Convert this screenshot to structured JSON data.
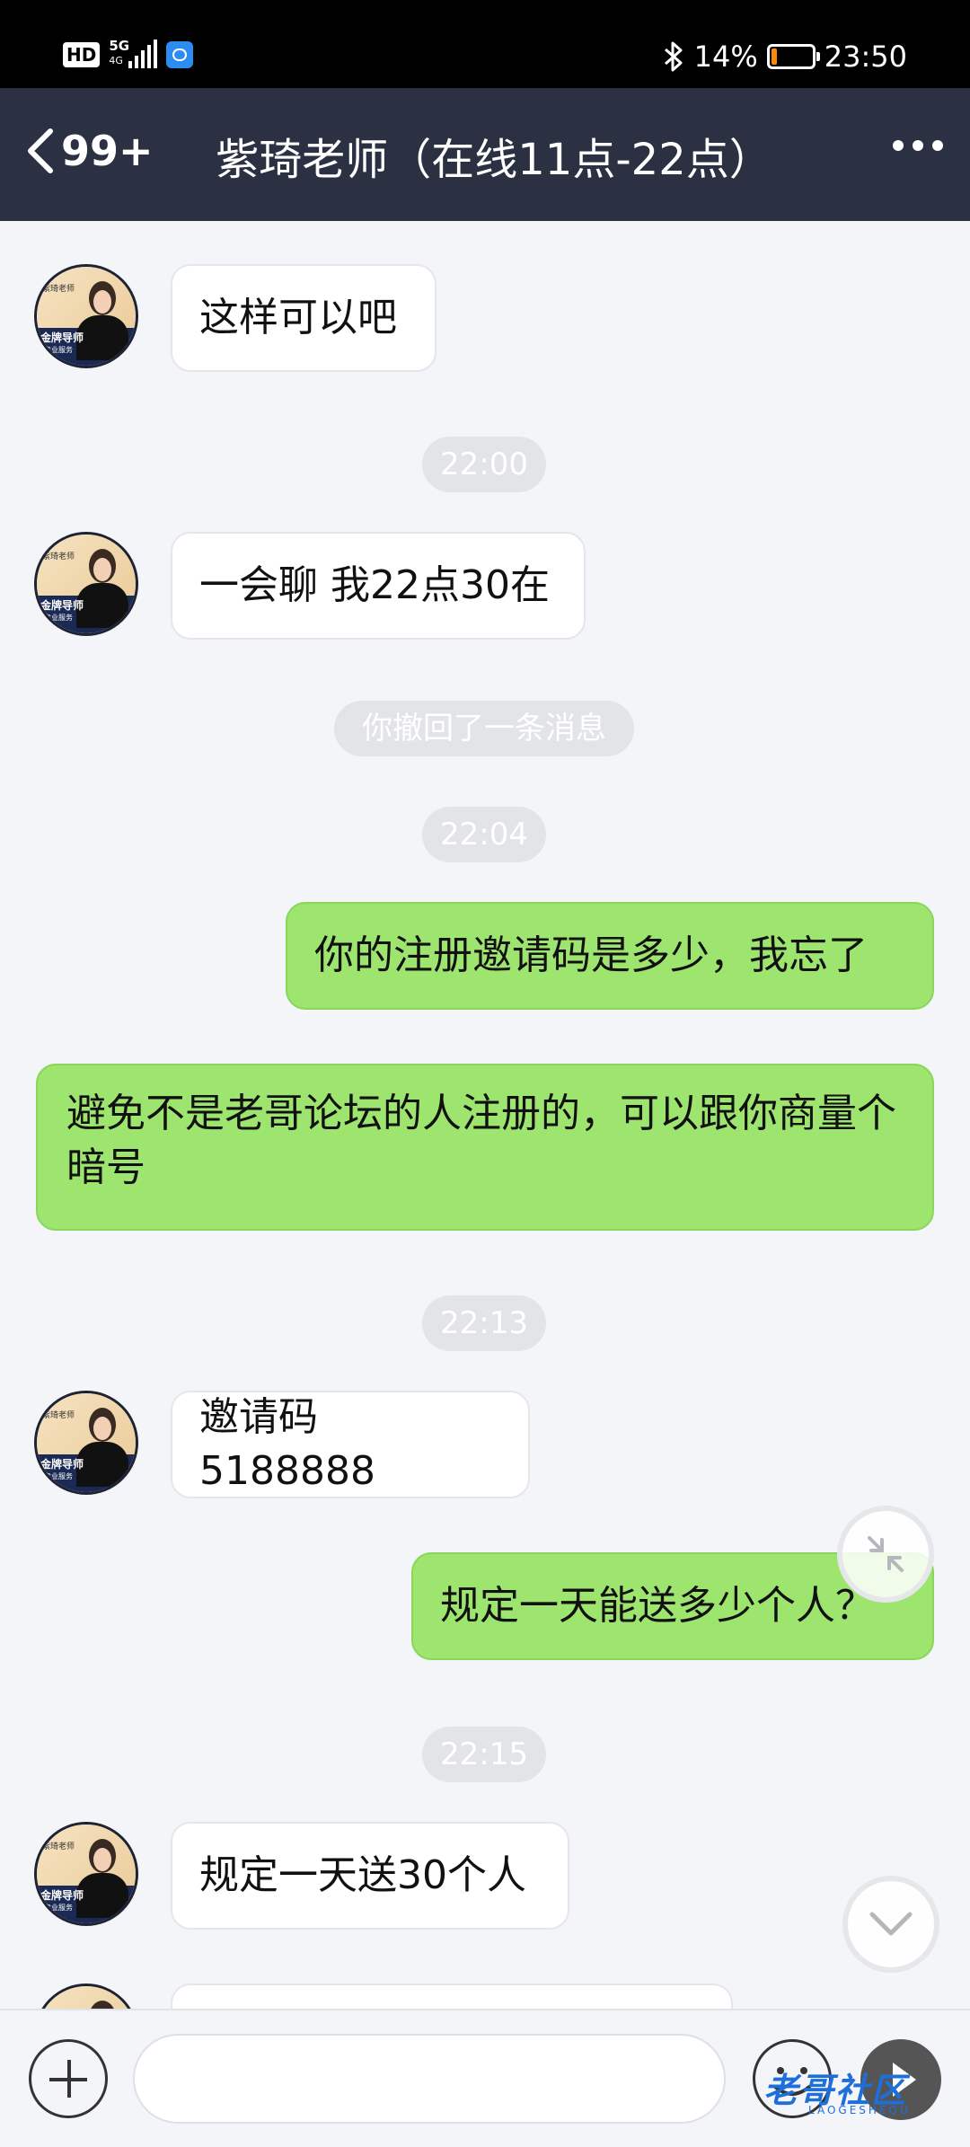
{
  "status_bar": {
    "hd": "HD",
    "network": "5G",
    "network_sub": "4G",
    "battery_percent": "14%",
    "battery_level": 0.14,
    "time": "23:50",
    "icons": [
      "signal-icon",
      "app-notification-icon",
      "bluetooth-icon",
      "battery-icon"
    ]
  },
  "header": {
    "back_count": "99+",
    "title": "紫琦老师（在线11点-22点）"
  },
  "avatar": {
    "line1": "紫琦老师",
    "line2": "金牌导师",
    "line3": "专业服务"
  },
  "messages": [
    {
      "type": "in",
      "text": "这样可以吧"
    },
    {
      "type": "time",
      "text": "22:00"
    },
    {
      "type": "in",
      "text": "一会聊 我22点30在"
    },
    {
      "type": "system",
      "text": "你撤回了一条消息"
    },
    {
      "type": "time",
      "text": "22:04"
    },
    {
      "type": "out",
      "text": "你的注册邀请码是多少，我忘了"
    },
    {
      "type": "out",
      "text": "避免不是老哥论坛的人注册的，可以跟你商量个暗号"
    },
    {
      "type": "time",
      "text": "22:13"
    },
    {
      "type": "in",
      "text": "邀请码 5188888"
    },
    {
      "type": "out",
      "text": "规定一天能送多少个人？"
    },
    {
      "type": "time",
      "text": "22:15"
    },
    {
      "type": "in",
      "text": "规定一天送30个人"
    }
  ],
  "input": {
    "placeholder": ""
  },
  "watermark": {
    "text": "老哥社区",
    "sub": "LAOGESHEQU"
  },
  "colors": {
    "nav_bg": "#2b3042",
    "outgoing_bubble": "#9ee56f",
    "incoming_bubble": "#ffffff",
    "chat_bg": "#f4f5f9",
    "battery_fill": "#ff8a00"
  }
}
